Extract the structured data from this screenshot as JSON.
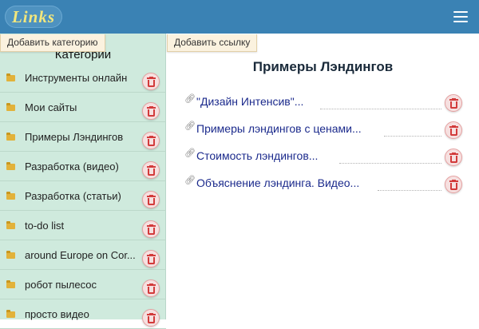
{
  "header": {
    "logo": "Links",
    "menu_icon": "hamburger-menu-icon"
  },
  "sidebar": {
    "add_category_label": "Добавить категорию",
    "title": "Категории",
    "folder_icon": "folder-icon",
    "delete_icon": "trash-icon",
    "categories": [
      "Инструменты онлайн",
      "Мои сайты",
      "Примеры Лэндингов",
      "Разработка (видео)",
      "Разработка (статьи)",
      "to-do list",
      "around Europe on Cor...",
      "робот пылесос",
      "просто видео"
    ]
  },
  "main": {
    "add_link_label": "Добавить ссылку",
    "title": "Примеры Лэндингов",
    "link_icon": "chain-link-icon",
    "links": [
      "\"Дизайн Интенсив\"...",
      "Примеры лэндингов с ценами...",
      "Стоимость лэндингов...",
      "Объяснение лэндинга. Видео..."
    ]
  },
  "colors": {
    "header": "#3a82b4",
    "logo_text": "#f3e77c",
    "sidebar": "#cfeadd",
    "link_text": "#1b2a8c",
    "delete": "#d23b3b"
  }
}
